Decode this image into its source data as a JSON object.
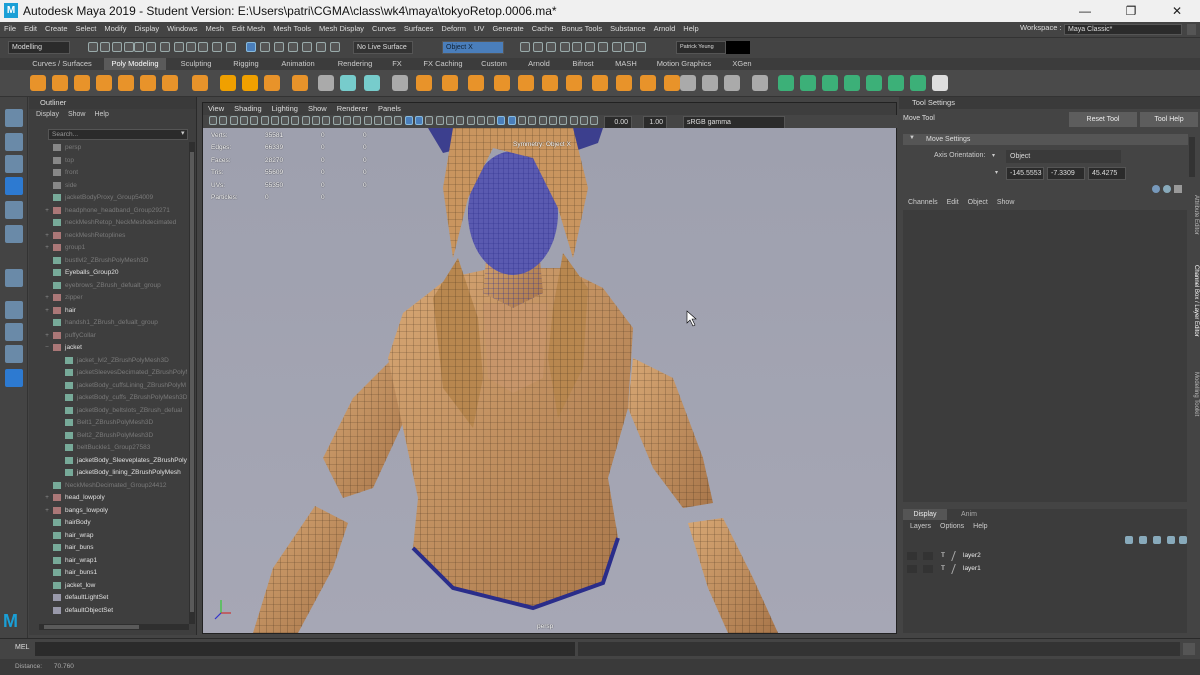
{
  "title_bar": {
    "app_title": "Autodesk Maya 2019 - Student Version: E:\\Users\\patri\\CGMA\\class\\wk4\\maya\\tokyoRetop.0006.ma*",
    "logo": "M",
    "minimize": "—",
    "maximize": "❐",
    "close": "✕"
  },
  "menubar": {
    "items": [
      "File",
      "Edit",
      "Create",
      "Select",
      "Modify",
      "Display",
      "Windows",
      "Mesh",
      "Edit Mesh",
      "Mesh Tools",
      "Mesh Display",
      "Curves",
      "Surfaces",
      "Deform",
      "UV",
      "Generate",
      "Cache",
      "Bonus Tools",
      "Substance",
      "Arnold",
      "Help"
    ],
    "workspace_label": "Workspace :",
    "workspace_value": "Maya Classic*"
  },
  "status_line": {
    "mode": "Modelling",
    "live_surface": "No Live Surface",
    "symmetry": "Object X",
    "user": "Patrick Yeung"
  },
  "shelf": {
    "tabs": [
      "Curves / Surfaces",
      "Poly Modeling",
      "Sculpting",
      "Rigging",
      "Animation",
      "Rendering",
      "FX",
      "FX Caching",
      "Custom",
      "Arnold",
      "Bifrost",
      "MASH",
      "Motion Graphics",
      "XGen"
    ],
    "active_tab": "Poly Modeling"
  },
  "outliner": {
    "title": "Outliner",
    "menu": [
      "Display",
      "Show",
      "Help"
    ],
    "search_placeholder": "Search...",
    "items": [
      {
        "label": "persp",
        "indent": 0,
        "expand": "",
        "lit": false,
        "icon": "camera"
      },
      {
        "label": "top",
        "indent": 0,
        "expand": "",
        "lit": false,
        "icon": "camera"
      },
      {
        "label": "front",
        "indent": 0,
        "expand": "",
        "lit": false,
        "icon": "camera"
      },
      {
        "label": "side",
        "indent": 0,
        "expand": "",
        "lit": false,
        "icon": "camera"
      },
      {
        "label": "jacketBodyProxy_Group54009",
        "indent": 0,
        "expand": "",
        "lit": false,
        "icon": "mesh"
      },
      {
        "label": "headphone_headband_Group29271",
        "indent": 0,
        "expand": "+",
        "lit": false,
        "icon": "group"
      },
      {
        "label": "neckMeshRetop_NeckMeshdecimated",
        "indent": 0,
        "expand": "",
        "lit": false,
        "icon": "mesh"
      },
      {
        "label": "neckMeshRetoplines",
        "indent": 0,
        "expand": "+",
        "lit": false,
        "icon": "group"
      },
      {
        "label": "group1",
        "indent": 0,
        "expand": "+",
        "lit": false,
        "icon": "group"
      },
      {
        "label": "bustlvl2_ZBrushPolyMesh3D",
        "indent": 0,
        "expand": "",
        "lit": false,
        "icon": "mesh"
      },
      {
        "label": "Eyeballs_Group20",
        "indent": 0,
        "expand": "",
        "lit": true,
        "icon": "mesh"
      },
      {
        "label": "eyebrows_ZBrush_defualt_group",
        "indent": 0,
        "expand": "",
        "lit": false,
        "icon": "mesh"
      },
      {
        "label": "zipper",
        "indent": 0,
        "expand": "+",
        "lit": false,
        "icon": "group"
      },
      {
        "label": "hair",
        "indent": 0,
        "expand": "+",
        "lit": true,
        "icon": "group"
      },
      {
        "label": "handsh1_ZBrush_defualt_group",
        "indent": 0,
        "expand": "",
        "lit": false,
        "icon": "mesh"
      },
      {
        "label": "puffyCollar",
        "indent": 0,
        "expand": "+",
        "lit": false,
        "icon": "group"
      },
      {
        "label": "jacket",
        "indent": 0,
        "expand": "−",
        "lit": true,
        "icon": "group"
      },
      {
        "label": "jacket_lvl2_ZBrushPolyMesh3D",
        "indent": 1,
        "expand": "",
        "lit": false,
        "icon": "mesh"
      },
      {
        "label": "jacketSleevesDecimated_ZBrushPolyM",
        "indent": 1,
        "expand": "",
        "lit": false,
        "icon": "mesh"
      },
      {
        "label": "jacketBody_cuffsLining_ZBrushPolyM",
        "indent": 1,
        "expand": "",
        "lit": false,
        "icon": "mesh"
      },
      {
        "label": "jacketBody_cuffs_ZBrushPolyMesh3D",
        "indent": 1,
        "expand": "",
        "lit": false,
        "icon": "mesh"
      },
      {
        "label": "jacketBody_beltslots_ZBrush_defual",
        "indent": 1,
        "expand": "",
        "lit": false,
        "icon": "mesh"
      },
      {
        "label": "Belt1_ZBrushPolyMesh3D",
        "indent": 1,
        "expand": "",
        "lit": false,
        "icon": "mesh"
      },
      {
        "label": "Belt2_ZBrushPolyMesh3D",
        "indent": 1,
        "expand": "",
        "lit": false,
        "icon": "mesh"
      },
      {
        "label": "beltBuckle1_Group27583",
        "indent": 1,
        "expand": "",
        "lit": false,
        "icon": "mesh"
      },
      {
        "label": "jacketBody_Sleeveplates_ZBrushPoly",
        "indent": 1,
        "expand": "",
        "lit": true,
        "icon": "mesh"
      },
      {
        "label": "jacketBody_lining_ZBrushPolyMesh",
        "indent": 1,
        "expand": "",
        "lit": true,
        "icon": "mesh"
      },
      {
        "label": "NeckMeshDecimated_Group24412",
        "indent": 0,
        "expand": "",
        "lit": false,
        "icon": "mesh"
      },
      {
        "label": "head_lowpoly",
        "indent": 0,
        "expand": "+",
        "lit": true,
        "icon": "group"
      },
      {
        "label": "bangs_lowpoly",
        "indent": 0,
        "expand": "+",
        "lit": true,
        "icon": "group"
      },
      {
        "label": "hairBody",
        "indent": 0,
        "expand": "",
        "lit": true,
        "icon": "mesh"
      },
      {
        "label": "hair_wrap",
        "indent": 0,
        "expand": "",
        "lit": true,
        "icon": "mesh"
      },
      {
        "label": "hair_buns",
        "indent": 0,
        "expand": "",
        "lit": true,
        "icon": "mesh"
      },
      {
        "label": "hair_wrap1",
        "indent": 0,
        "expand": "",
        "lit": true,
        "icon": "mesh"
      },
      {
        "label": "hair_buns1",
        "indent": 0,
        "expand": "",
        "lit": true,
        "icon": "mesh"
      },
      {
        "label": "jacket_low",
        "indent": 0,
        "expand": "",
        "lit": true,
        "icon": "mesh"
      },
      {
        "label": "defaultLightSet",
        "indent": 0,
        "expand": "",
        "lit": true,
        "icon": "set"
      },
      {
        "label": "defaultObjectSet",
        "indent": 0,
        "expand": "",
        "lit": true,
        "icon": "set"
      }
    ]
  },
  "viewport": {
    "menu": [
      "View",
      "Shading",
      "Lighting",
      "Show",
      "Renderer",
      "Panels"
    ],
    "exposure": "0.00",
    "gamma": "1.00",
    "colorspace": "sRGB gamma",
    "symmetry_label": "Symmetry: Object X",
    "camera_label": "persp",
    "hud": [
      {
        "label": "Verts:",
        "a": "35581",
        "b": "0",
        "c": "0"
      },
      {
        "label": "Edges:",
        "a": "66339",
        "b": "0",
        "c": "0"
      },
      {
        "label": "Faces:",
        "a": "28270",
        "b": "0",
        "c": "0"
      },
      {
        "label": "Tris:",
        "a": "55609",
        "b": "0",
        "c": "0"
      },
      {
        "label": "UVs:",
        "a": "55350",
        "b": "0",
        "c": "0"
      },
      {
        "label": "Particles:",
        "a": "0",
        "b": "0",
        "c": ""
      }
    ]
  },
  "tool_settings": {
    "title": "Tool Settings",
    "tool_name": "Move Tool",
    "reset": "Reset Tool",
    "help": "Tool Help",
    "section": "Move Settings",
    "axis_label": "Axis Orientation:",
    "axis_value": "Object",
    "x": "-145.5553",
    "y": "-7.3309",
    "z": "45.4275"
  },
  "channel_box": {
    "menu": [
      "Channels",
      "Edit",
      "Object",
      "Show"
    ]
  },
  "side_tabs": [
    "Attribute Editor",
    "Channel Box / Layer Editor",
    "Modelling Toolkit"
  ],
  "layer_editor": {
    "tabs": [
      "Display",
      "Anim"
    ],
    "menu": [
      "Layers",
      "Options",
      "Help"
    ],
    "layers": [
      {
        "visible": "T",
        "name": "layer2"
      },
      {
        "visible": "T",
        "name": "layer1"
      }
    ]
  },
  "command_line": {
    "label": "MEL"
  },
  "help_line": {
    "label": "Distance:",
    "value": "70.760"
  },
  "colors": {
    "accent": "#4a7ebb",
    "viewport_bg": "#a2a3b1",
    "skin": "#c89a68"
  }
}
